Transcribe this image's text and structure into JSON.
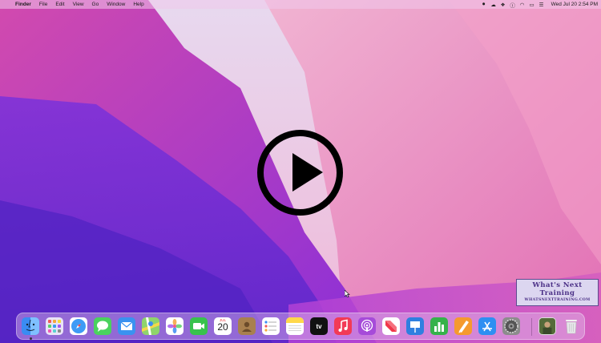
{
  "menubar": {
    "apple_glyph": "",
    "app_name": "Finder",
    "menus": [
      "File",
      "Edit",
      "View",
      "Go",
      "Window",
      "Help"
    ],
    "clock": "Wed Jul 20  2:54 PM",
    "status_icons": [
      "record-icon",
      "cloud-icon",
      "dropbox-icon",
      "info-icon",
      "wifi-icon",
      "battery-icon",
      "control-center-icon"
    ]
  },
  "watermark": {
    "line1": "What's Next",
    "line2": "Training",
    "line3": "WHATSNEXTTRAINING.COM",
    "color": "#4a2f86"
  },
  "dock": {
    "apps": [
      {
        "name": "Finder",
        "icon": "finder-icon",
        "running": true
      },
      {
        "name": "Launchpad",
        "icon": "launchpad-icon"
      },
      {
        "name": "Safari",
        "icon": "safari-icon"
      },
      {
        "name": "Messages",
        "icon": "messages-icon"
      },
      {
        "name": "Mail",
        "icon": "mail-icon"
      },
      {
        "name": "Maps",
        "icon": "maps-icon"
      },
      {
        "name": "Photos",
        "icon": "photos-icon"
      },
      {
        "name": "FaceTime",
        "icon": "facetime-icon"
      },
      {
        "name": "Calendar",
        "icon": "calendar-icon",
        "month": "JUL",
        "day": "20"
      },
      {
        "name": "Contacts",
        "icon": "contacts-icon"
      },
      {
        "name": "Reminders",
        "icon": "reminders-icon"
      },
      {
        "name": "Notes",
        "icon": "notes-icon"
      },
      {
        "name": "TV",
        "icon": "tv-icon",
        "label": "tv"
      },
      {
        "name": "Music",
        "icon": "music-icon"
      },
      {
        "name": "Podcasts",
        "icon": "podcasts-icon"
      },
      {
        "name": "News",
        "icon": "news-icon"
      },
      {
        "name": "Keynote",
        "icon": "keynote-icon"
      },
      {
        "name": "Numbers",
        "icon": "numbers-icon"
      },
      {
        "name": "Pages",
        "icon": "pages-icon"
      },
      {
        "name": "App Store",
        "icon": "app-store-icon"
      },
      {
        "name": "System Preferences",
        "icon": "system-preferences-icon"
      }
    ],
    "extras": [
      {
        "name": "Downloads",
        "icon": "downloads-stack-icon"
      },
      {
        "name": "Trash",
        "icon": "trash-icon"
      }
    ]
  },
  "colors": {
    "finder": "#3a8cf3",
    "launchpad": "#e9e3f7",
    "safari": "#3e9bf5",
    "messages": "#4ad25e",
    "mail": "#3a92f0",
    "maps": "#8fd46c",
    "photos": "#ffffff",
    "facetime": "#38c24d",
    "contacts": "#a8804f",
    "reminders": "#ffffff",
    "notes": "#ffd84a",
    "tv": "#111111",
    "music": "#f23a56",
    "podcasts": "#a64bd9",
    "news": "#ffffff",
    "keynote": "#2f7fe0",
    "numbers": "#35b24a",
    "pages": "#f59a2e",
    "app_store": "#2e8ff2",
    "system_preferences": "#8c8c8c"
  }
}
